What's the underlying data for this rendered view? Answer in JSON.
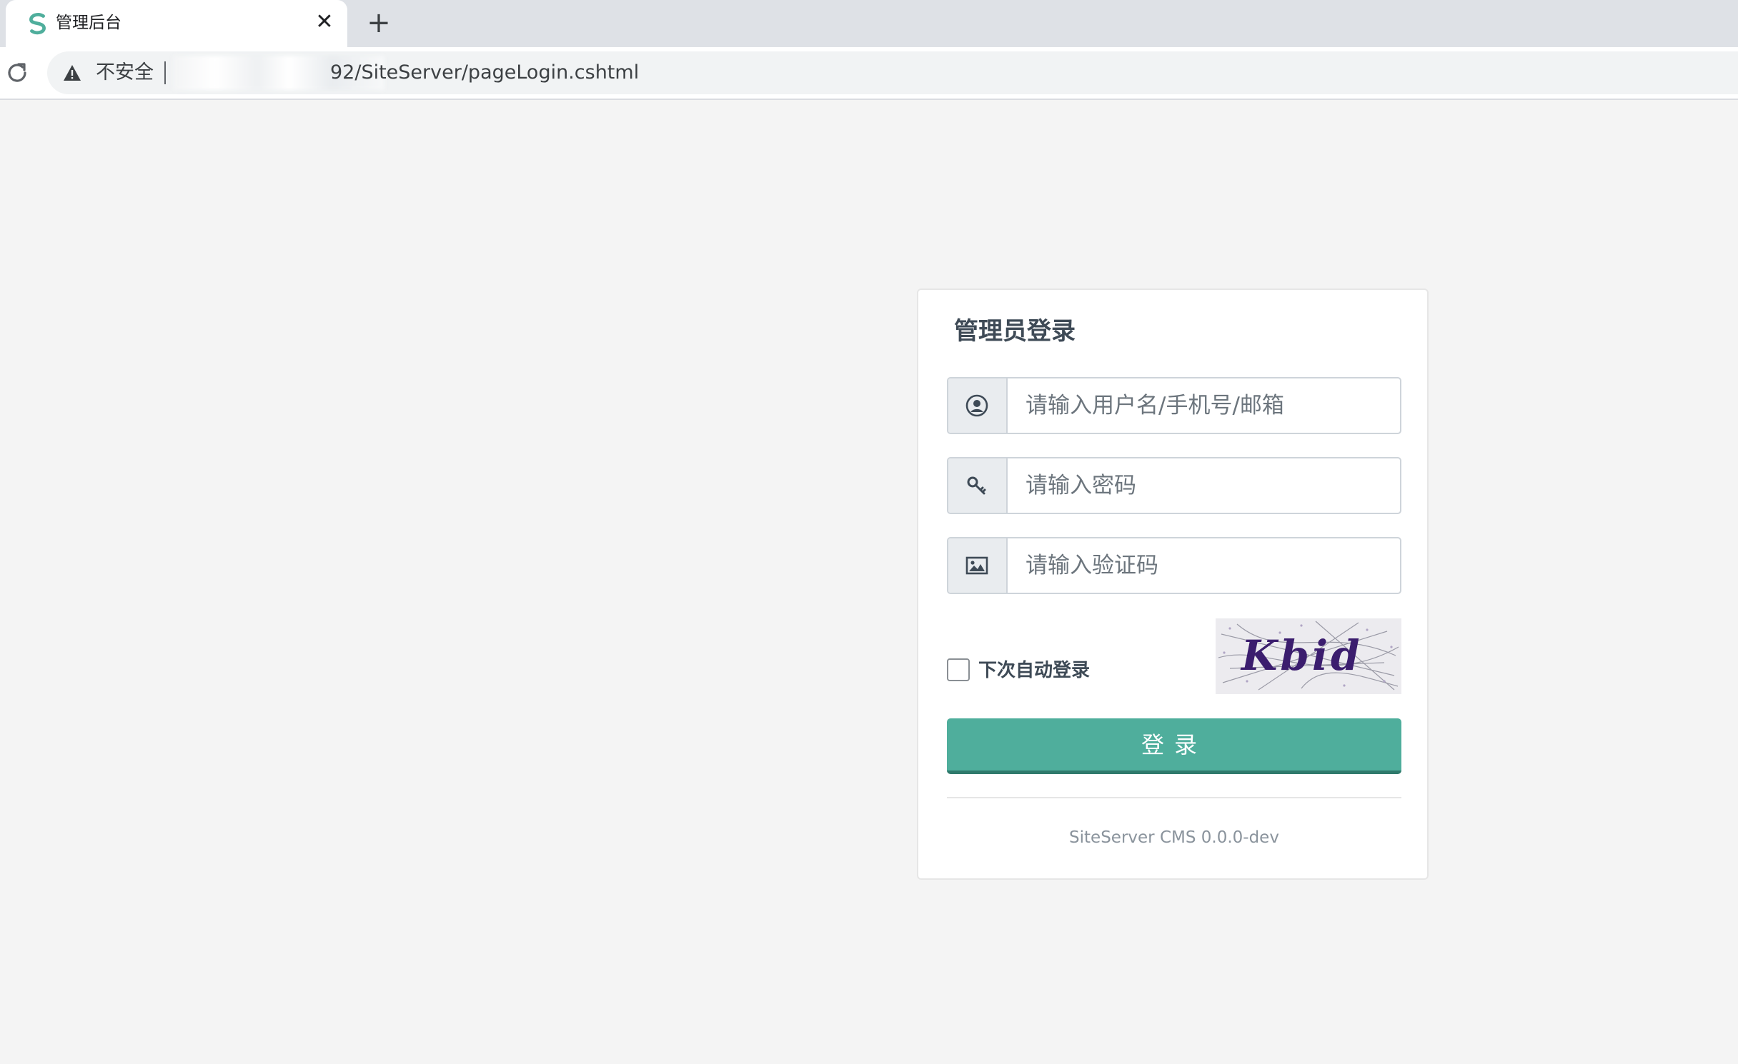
{
  "browser": {
    "tab_title": "管理后台",
    "tab_close": "✕",
    "new_tab": "+",
    "insecure_label": "不安全",
    "url_path": "92/SiteServer/pageLogin.cshtml"
  },
  "login": {
    "title": "管理员登录",
    "username_placeholder": "请输入用户名/手机号/邮箱",
    "password_placeholder": "请输入密码",
    "captcha_placeholder": "请输入验证码",
    "remember_label": "下次自动登录",
    "remember_checked": false,
    "captcha_text": "Kbid",
    "submit_label": "登录",
    "version": "SiteServer CMS 0.0.0-dev"
  },
  "colors": {
    "accent": "#4fae9c",
    "page_bg": "#f4f4f4",
    "favicon": "#4fae9c"
  },
  "icons": {
    "favicon": "siteserver-logo-icon",
    "username": "user-circle-icon",
    "password": "key-icon",
    "captcha": "image-icon",
    "reload": "reload-icon",
    "warning": "warning-icon"
  }
}
